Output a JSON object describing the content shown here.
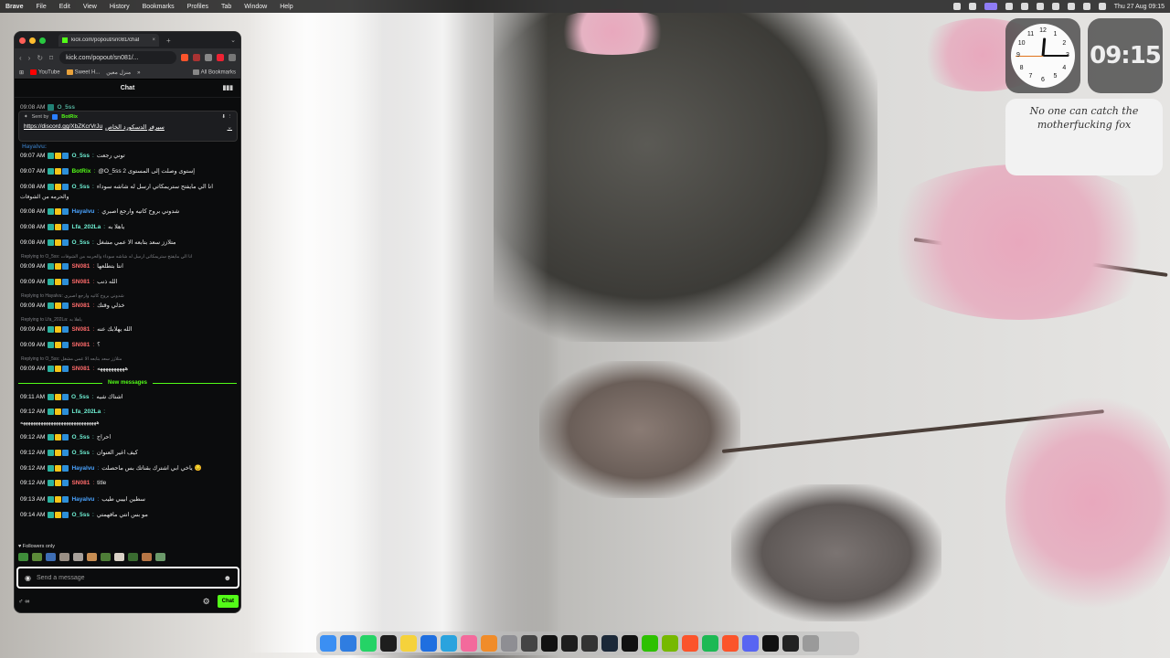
{
  "menubar": {
    "app": "Brave",
    "items": [
      "File",
      "Edit",
      "View",
      "History",
      "Bookmarks",
      "Profiles",
      "Tab",
      "Window",
      "Help"
    ],
    "datetime": "Thu 27 Aug 09:15"
  },
  "browser": {
    "tab_title": "kick.com/popout/sn081/chat",
    "tab_close": "×",
    "new_tab": "+",
    "tab_menu": "⌄",
    "url": "kick.com/popout/sn081/...",
    "bookmarks": {
      "apps": "⊞",
      "youtube": "YouTube",
      "sweet": "Sweet H...",
      "arabic": "منزل معين",
      "more": "»",
      "all": "All Bookmarks"
    }
  },
  "chat": {
    "header": "Chat",
    "stats_icon": "▮▮▮",
    "pinned": {
      "sent_by_label": "Sent by",
      "sender": "BotRix",
      "link": "https://discord.gg/XbZKcrVrJu",
      "text": "سيرفر الدسكورد الخاص",
      "expand": "⌄"
    },
    "peek_top": "09:08 AM",
    "peek_user": "O_5ss",
    "peek_cut": "Hayalvu:",
    "messages": [
      {
        "time": "09:07 AM",
        "user": "O_5ss",
        "color": "#6ff0d4",
        "text": "توني رجعت"
      },
      {
        "time": "09:07 AM",
        "user": "BotRix",
        "color": "#53fc18",
        "text": "@O_5ss 2 إستوى وصلت إلى المستوى"
      },
      {
        "time": "09:08 AM",
        "user": "O_5ss",
        "color": "#6ff0d4",
        "text": "انا الي مايفتح ستريمكاتي ارسل له شاشه سوداء",
        "cont": "والحرمه من الشوفات"
      },
      {
        "time": "09:08 AM",
        "user": "Hayalvu",
        "color": "#4aa3ff",
        "text": "شدوني بروح كاتيه وارجع اصبري"
      },
      {
        "time": "09:08 AM",
        "user": "Lfa_202La",
        "color": "#6ff0d4",
        "text": "ياهلا به"
      },
      {
        "time": "09:08 AM",
        "user": "O_5ss",
        "color": "#6ff0d4",
        "text": "متلازز سعد بتابعه الا عمي مشغل"
      },
      {
        "reply": "Replying to O_5ss: انا الي مايفتح ستريمكاتي ارسل له شاشه سوداء والحرمه من الشوفات",
        "time": "09:09 AM",
        "user": "SN081",
        "color": "#ff6b6b",
        "text": "انتا بتطلعها"
      },
      {
        "time": "09:09 AM",
        "user": "SN081",
        "color": "#ff6b6b",
        "text": "الله ذنب"
      },
      {
        "reply": "Replying to Hayalvu: شدوني بروح كاتيه وارجع اصبري",
        "time": "09:09 AM",
        "user": "SN081",
        "color": "#ff6b6b",
        "text": "خذلي وقتك"
      },
      {
        "reply": "Replying to Lfa_202La: ياهلا به",
        "time": "09:09 AM",
        "user": "SN081",
        "color": "#ff6b6b",
        "text": "الله يهلابك عنه"
      },
      {
        "time": "09:09 AM",
        "user": "SN081",
        "color": "#ff6b6b",
        "text": "؟"
      },
      {
        "reply": "Replying to O_5ss: متلازز سعد بتابعه الا عمي مشغل",
        "time": "09:09 AM",
        "user": "SN081",
        "color": "#ff6b6b",
        "text": "ههههههههههه"
      }
    ],
    "new_messages_label": "New messages",
    "new_messages": [
      {
        "time": "09:11 AM",
        "user": "O_5ss",
        "color": "#6ff0d4",
        "text": "اشتاك شيه"
      },
      {
        "time": "09:12 AM",
        "user": "Lfa_202La",
        "color": "#6ff0d4",
        "text": "",
        "cont": "ههههههههههههههههههههههههههههههه"
      },
      {
        "time": "09:12 AM",
        "user": "O_5ss",
        "color": "#6ff0d4",
        "text": "احراج"
      },
      {
        "time": "09:12 AM",
        "user": "O_5ss",
        "color": "#6ff0d4",
        "text": "كيف اغير العنوان"
      },
      {
        "time": "09:12 AM",
        "user": "Hayalvu",
        "color": "#4aa3ff",
        "text": "ياخي ابي اشترك بقناتك بس ماحصلت 😔"
      },
      {
        "time": "09:12 AM",
        "user": "SN081",
        "color": "#ff6b6b",
        "text": "title"
      },
      {
        "time": "09:13 AM",
        "user": "Hayalvu",
        "color": "#4aa3ff",
        "text": "سطين ابيبي طيب"
      },
      {
        "time": "09:14 AM",
        "user": "O_5ss",
        "color": "#6ff0d4",
        "text": "مو بس انتي مافهمتي"
      }
    ],
    "followers_only": "Followers only",
    "input_placeholder": "Send a message",
    "send_label": "Chat",
    "bottom_left": "♂ ∞"
  },
  "widgets": {
    "clock_numbers": [
      "12",
      "1",
      "2",
      "3",
      "4",
      "5",
      "6",
      "7",
      "8",
      "9",
      "10",
      "11"
    ],
    "digital_time": "09:15",
    "note": "No one can catch the motherfucking fox"
  },
  "colors": {
    "kick_green": "#53fc18",
    "chat_bg": "#0b0c0d"
  }
}
